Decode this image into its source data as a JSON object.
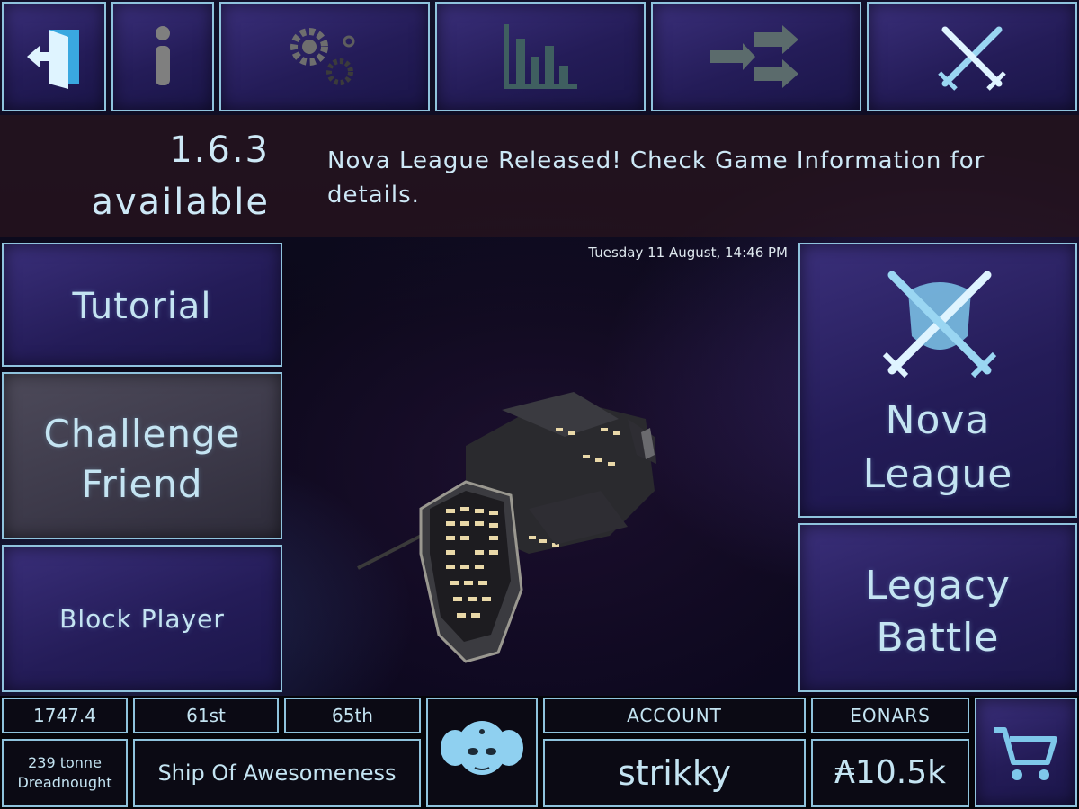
{
  "toolbar": {
    "icons": [
      "exit-door-icon",
      "info-icon",
      "settings-gears-icon",
      "stats-bar-chart-icon",
      "share-arrows-icon",
      "crossed-swords-icon"
    ]
  },
  "banner": {
    "version_line1": "1.6.3",
    "version_line2": "available",
    "news": "Nova League Released! Check Game Information for details."
  },
  "left_menu": {
    "tutorial": "Tutorial",
    "challenge_line1": "Challenge",
    "challenge_line2": "Friend",
    "block_player": "Block Player"
  },
  "center": {
    "datetime": "Tuesday 11 August, 14:46 PM"
  },
  "right_menu": {
    "nova_line1": "Nova",
    "nova_line2": "League",
    "legacy_line1": "Legacy",
    "legacy_line2": "Battle"
  },
  "footer": {
    "rating": "1747.4",
    "rank1": "61st",
    "rank2": "65th",
    "ship_class_line1": "239 tonne",
    "ship_class_line2": "Dreadnought",
    "ship_name": "Ship Of Awesomeness",
    "account_label": "ACCOUNT",
    "account_name": "strikky",
    "currency_label": "EONARS",
    "currency_value": "₳10.5k"
  },
  "colors": {
    "border": "#8fc3dd",
    "text": "#c4e4f2",
    "panel": "#2a2262"
  }
}
